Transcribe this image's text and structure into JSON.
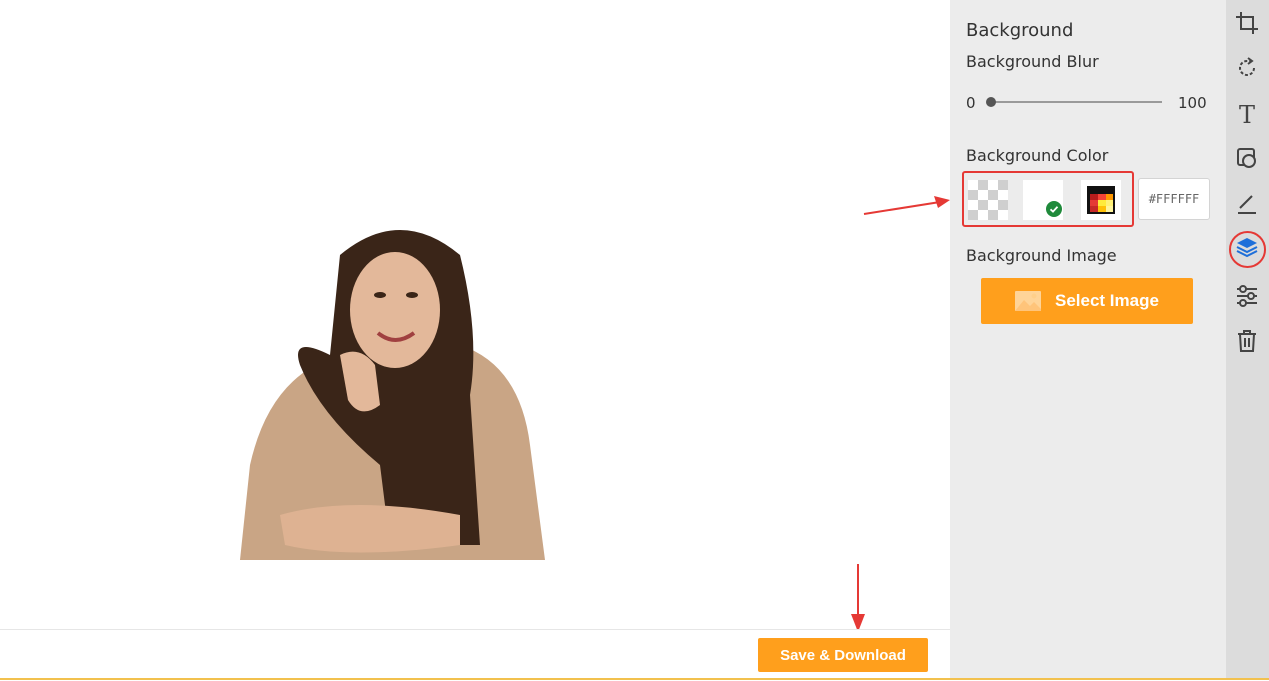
{
  "canvas": {
    "save_button": "Save & Download"
  },
  "panel": {
    "title": "Background",
    "blur": {
      "label": "Background Blur",
      "min": "0",
      "max": "100",
      "value": 0
    },
    "color": {
      "label": "Background Color",
      "selected": "white",
      "hex_value": "#FFFFFF"
    },
    "image": {
      "label": "Background Image",
      "button": "Select Image"
    }
  },
  "toolbar": {
    "items": [
      "crop-icon",
      "rotate-icon",
      "text-icon",
      "shape-icon",
      "draw-icon",
      "layers-icon",
      "adjust-icon",
      "trash-icon"
    ],
    "active": "layers-icon"
  },
  "colors": {
    "accent": "#ff9f1c",
    "highlight": "#e53935",
    "active_tool": "#1e6fd9"
  }
}
